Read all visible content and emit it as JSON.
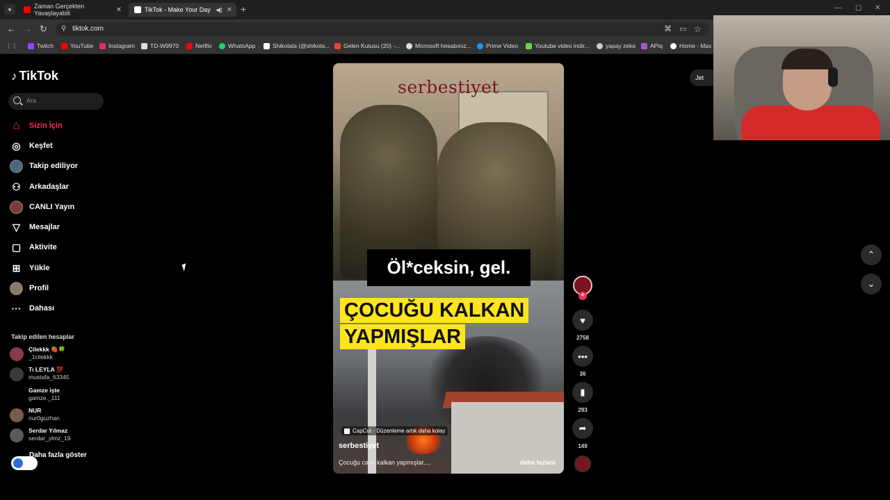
{
  "browser": {
    "tabs": [
      {
        "title": "Zaman Gerçekten Yavaşlayabili",
        "fav_color": "#ff0000"
      },
      {
        "title": "TikTok - Make Your Day",
        "fav_color": "#ffffff"
      }
    ],
    "url": "tiktok.com",
    "bookmarks": [
      {
        "label": "Twitch",
        "color": "#9146ff"
      },
      {
        "label": "YouTube",
        "color": "#ff0000"
      },
      {
        "label": "Instagram",
        "color": "#e1306c"
      },
      {
        "label": "TD-W9970",
        "color": "#dddddd"
      },
      {
        "label": "Netflix",
        "color": "#e50914"
      },
      {
        "label": "WhatsApp",
        "color": "#25d366"
      },
      {
        "label": "Shikolata (@shikola...",
        "color": "#ffffff"
      },
      {
        "label": "Gelen Kutusu (20) -...",
        "color": "#ea4335"
      },
      {
        "label": "Microsoft hesabınız...",
        "color": "#dddddd"
      },
      {
        "label": "Prime Video",
        "color": "#1a98ff"
      },
      {
        "label": "Youtube video indir...",
        "color": "#6fd34a"
      },
      {
        "label": "yapay zeka",
        "color": "#cccccc"
      },
      {
        "label": "APiq",
        "color": "#a05ad6"
      },
      {
        "label": "Home - Max",
        "color": "#ffffff"
      }
    ]
  },
  "sidebar": {
    "logo": "TikTok",
    "search_placeholder": "Ara",
    "items": [
      {
        "label": "Sizin İçin",
        "icon": "home-icon",
        "glyph": "⌂"
      },
      {
        "label": "Keşfet",
        "icon": "compass-icon",
        "glyph": "◎"
      },
      {
        "label": "Takip ediliyor",
        "icon": "following-icon",
        "glyph": ""
      },
      {
        "label": "Arkadaşlar",
        "icon": "friends-icon",
        "glyph": "⚇"
      },
      {
        "label": "CANLI Yayın",
        "icon": "live-icon",
        "glyph": ""
      },
      {
        "label": "Mesajlar",
        "icon": "message-icon",
        "glyph": "▽"
      },
      {
        "label": "Aktivite",
        "icon": "activity-icon",
        "glyph": "▢"
      },
      {
        "label": "Yükle",
        "icon": "upload-icon",
        "glyph": "⊞"
      },
      {
        "label": "Profil",
        "icon": "profile-icon",
        "glyph": ""
      },
      {
        "label": "Dahası",
        "icon": "more-icon",
        "glyph": "···"
      }
    ],
    "following_title": "Takip edilen hesaplar",
    "following": [
      {
        "name": "Çilekkk 🍓🍀",
        "user": "_1cilekkk"
      },
      {
        "name": "Tı LEYLA 💯",
        "user": "mustafa_63345"
      },
      {
        "name": "Gamze işte",
        "user": "gamze._111"
      },
      {
        "name": "NUR",
        "user": "nur0guzhan"
      },
      {
        "name": "Serdar Yılmaz",
        "user": "serdar_ylmz_19"
      }
    ],
    "show_more": "Daha fazla göster"
  },
  "video": {
    "brand": "serbestiyet",
    "caption_top": "Öl*ceksin, gel.",
    "caption_line1": "ÇOCUĞU KALKAN",
    "caption_line2": "YAPMIŞLAR",
    "capcut": "CapCut · Düzenleme artık daha kolay",
    "author": "serbestiyet",
    "description": "Çocuğu canlı kalkan yapmışlar....",
    "more": "daha fazlası"
  },
  "actions": {
    "likes": "2758",
    "comments": "36",
    "saves": "293",
    "shares": "149"
  },
  "get_app": "Jet"
}
